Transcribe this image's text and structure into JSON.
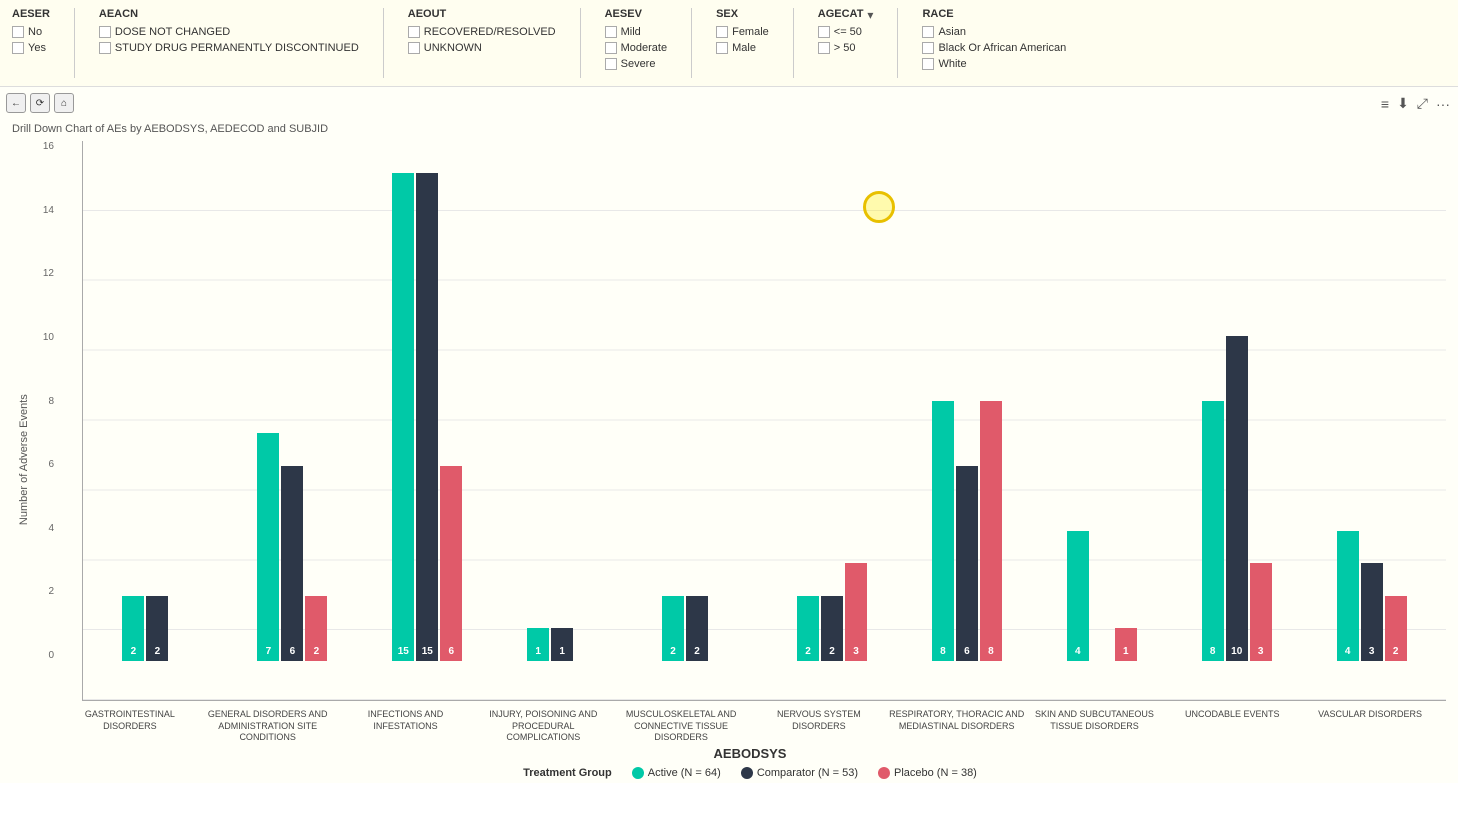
{
  "filters": {
    "aeser": {
      "label": "AESER",
      "options": [
        {
          "label": "No",
          "checked": false
        },
        {
          "label": "Yes",
          "checked": false
        }
      ]
    },
    "aeacn": {
      "label": "AEACN",
      "options": [
        {
          "label": "DOSE NOT CHANGED",
          "checked": false
        },
        {
          "label": "STUDY DRUG PERMANENTLY DISCONTINUED",
          "checked": false
        }
      ]
    },
    "aeout": {
      "label": "AEOUT",
      "options": [
        {
          "label": "RECOVERED/RESOLVED",
          "checked": false
        },
        {
          "label": "UNKNOWN",
          "checked": false
        }
      ]
    },
    "aesev": {
      "label": "AESEV",
      "options": [
        {
          "label": "Mild",
          "checked": false
        },
        {
          "label": "Moderate",
          "checked": false
        },
        {
          "label": "Severe",
          "checked": false
        }
      ]
    },
    "sex": {
      "label": "SEX",
      "options": [
        {
          "label": "Female",
          "checked": false
        },
        {
          "label": "Male",
          "checked": false
        }
      ]
    },
    "agecat": {
      "label": "AGECAT",
      "options": [
        {
          "label": "<= 50",
          "checked": false
        },
        {
          "label": "> 50",
          "checked": false
        }
      ]
    },
    "race": {
      "label": "RACE",
      "options": [
        {
          "label": "Asian",
          "checked": false
        },
        {
          "label": "Black Or African American",
          "checked": false
        },
        {
          "label": "White",
          "checked": false
        }
      ]
    }
  },
  "chart": {
    "title": "Drill Down Chart of AEs by AEBODSYS, AEDECOD and SUBJID",
    "yAxisLabel": "Number of Adverse Events",
    "xAxisLabel": "AEBODSYS",
    "yMax": 16,
    "yTicks": [
      0,
      2,
      4,
      6,
      8,
      10,
      12,
      14,
      16
    ],
    "barGroups": [
      {
        "label": "GASTROINTESTINAL\nDISORDERS",
        "active": 2,
        "comparator": 2,
        "placebo": 0
      },
      {
        "label": "GENERAL DISORDERS AND ADMINISTRATION SITE CONDITIONS",
        "active": 7,
        "comparator": 6,
        "placebo": 2
      },
      {
        "label": "INFECTIONS AND\nINFESTATIONS",
        "active": 15,
        "comparator": 15,
        "placebo": 6
      },
      {
        "label": "INJURY, POISONING AND PROCEDURAL COMPLICATIONS",
        "active": 1,
        "comparator": 1,
        "placebo": 0
      },
      {
        "label": "MUSCULOSKELETAL AND CONNECTIVE TISSUE DISORDERS",
        "active": 2,
        "comparator": 2,
        "placebo": 0
      },
      {
        "label": "NERVOUS SYSTEM\nDISORDERS",
        "active": 2,
        "comparator": 2,
        "placebo": 3
      },
      {
        "label": "RESPIRATORY, THORACIC AND MEDIASTINAL DISORDERS",
        "active": 8,
        "comparator": 6,
        "placebo": 8
      },
      {
        "label": "SKIN AND SUBCUTANEOUS TISSUE DISORDERS",
        "active": 4,
        "comparator": 0,
        "placebo": 1
      },
      {
        "label": "UNCODABLE EVENTS",
        "active": 8,
        "comparator": 10,
        "placebo": 3
      },
      {
        "label": "VASCULAR\nDISORDERS",
        "active": 4,
        "comparator": 3,
        "placebo": 2
      }
    ],
    "legend": {
      "items": [
        {
          "label": "Active (N = 64)",
          "color": "#00c9a7"
        },
        {
          "label": "Comparator (N = 53)",
          "color": "#2d3748"
        },
        {
          "label": "Placebo (N = 38)",
          "color": "#e05a6a"
        }
      ],
      "prefix": "Treatment Group"
    }
  }
}
